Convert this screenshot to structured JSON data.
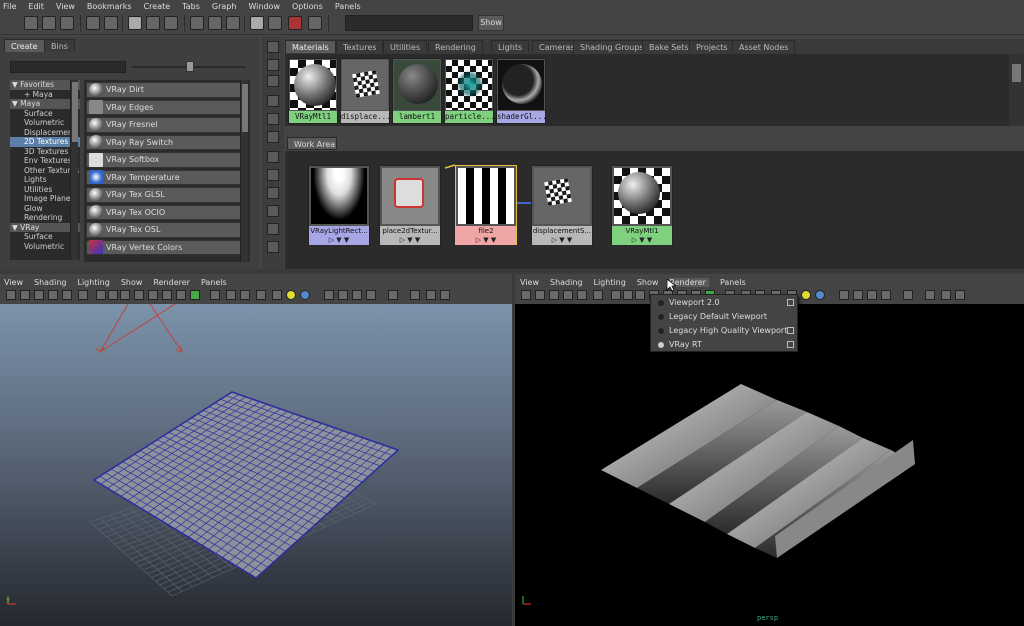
{
  "menubar": [
    "File",
    "Edit",
    "View",
    "Bookmarks",
    "Create",
    "Tabs",
    "Graph",
    "Window",
    "Options",
    "Panels"
  ],
  "toolbar": {
    "show_label": "Show"
  },
  "browser": {
    "tabs": [
      "Create",
      "Bins"
    ],
    "tree": [
      {
        "label": "Favorites",
        "type": "cat"
      },
      {
        "label": "+ Maya",
        "type": "item"
      },
      {
        "label": "Maya",
        "type": "cat"
      },
      {
        "label": "Surface",
        "type": "item"
      },
      {
        "label": "Volumetric",
        "type": "item"
      },
      {
        "label": "Displacement",
        "type": "item"
      },
      {
        "label": "2D Textures",
        "type": "sel"
      },
      {
        "label": "3D Textures",
        "type": "item"
      },
      {
        "label": "Env Textures",
        "type": "item"
      },
      {
        "label": "Other Textures",
        "type": "item"
      },
      {
        "label": "Lights",
        "type": "item"
      },
      {
        "label": "Utilities",
        "type": "item"
      },
      {
        "label": "Image Planes",
        "type": "item"
      },
      {
        "label": "Glow",
        "type": "item"
      },
      {
        "label": "Rendering",
        "type": "item"
      },
      {
        "label": "VRay",
        "type": "cat"
      },
      {
        "label": "Surface",
        "type": "item"
      },
      {
        "label": "Volumetric",
        "type": "item"
      }
    ],
    "nodes": [
      "VRay Dirt",
      "VRay Edges",
      "VRay Fresnel",
      "VRay Ray Switch",
      "VRay Softbox",
      "VRay Temperature",
      "VRay Tex GLSL",
      "VRay Tex OCIO",
      "VRay Tex OSL",
      "VRay Vertex Colors"
    ]
  },
  "hypershade": {
    "tabs": [
      "Materials",
      "Textures",
      "Utilities",
      "Rendering",
      "Lights",
      "Cameras",
      "Shading Groups",
      "Bake Sets",
      "Projects",
      "Asset Nodes"
    ],
    "swatches": [
      {
        "label": "VRayMtl1",
        "color": "#7fd17f",
        "img": "sphere"
      },
      {
        "label": "displace...",
        "color": "#b8b8b8",
        "img": "checker"
      },
      {
        "label": "lambert1",
        "color": "#7fd17f",
        "img": "sphere-dark"
      },
      {
        "label": "particle...",
        "color": "#7fd17f",
        "img": "particle"
      },
      {
        "label": "shaderGl...",
        "color": "#a7a7e6",
        "img": "glow"
      }
    ],
    "work_area_label": "Work Area",
    "work_nodes": [
      {
        "label": "VRayLightRect...",
        "color": "#a7a7e6",
        "img": "light"
      },
      {
        "label": "place2dTextur...",
        "color": "#b8b8b8",
        "img": "place2d"
      },
      {
        "label": "file2",
        "color": "#f0a6a6",
        "img": "stripes"
      },
      {
        "label": "displacementS...",
        "color": "#b8b8b8",
        "img": "checker"
      },
      {
        "label": "VRayMtl1",
        "color": "#7fd17f",
        "img": "sphere"
      }
    ],
    "port_glyphs": "▷  ▼  ▼"
  },
  "viewport_left": {
    "menu": [
      "View",
      "Shading",
      "Lighting",
      "Show",
      "Renderer",
      "Panels"
    ]
  },
  "viewport_right": {
    "menu": [
      "View",
      "Shading",
      "Lighting",
      "Show",
      "Renderer",
      "Panels"
    ],
    "camera_label": "persp"
  },
  "renderer_dropdown": {
    "items": [
      {
        "label": "Viewport 2.0",
        "selected": false,
        "box": true
      },
      {
        "label": "Legacy Default Viewport",
        "selected": false,
        "box": false
      },
      {
        "label": "Legacy High Quality Viewport",
        "selected": false,
        "box": true
      },
      {
        "label": "VRay RT",
        "selected": true,
        "box": true
      }
    ]
  },
  "colors": {
    "accent_selection": "#5c7fa8",
    "wire_blue": "#2a2aa0",
    "vp_bg_top": "#7c93ab"
  }
}
